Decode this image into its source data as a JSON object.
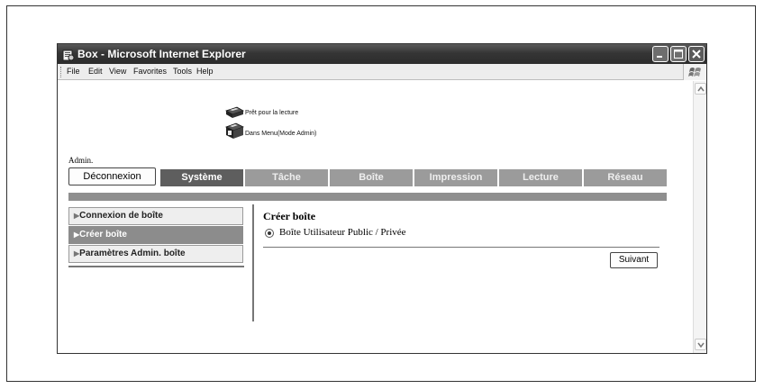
{
  "window": {
    "title": "Box - Microsoft Internet Explorer"
  },
  "menubar": {
    "items": [
      "File",
      "Edit",
      "View",
      "Favorites",
      "Tools",
      "Help"
    ]
  },
  "status": {
    "line1": "Prêt pour la lecture",
    "line2": "Dans Menu(Mode Admin)"
  },
  "user": {
    "label": "Admin."
  },
  "tabs": {
    "logout": "Déconnexion",
    "items": [
      {
        "label": "Système",
        "state": "active"
      },
      {
        "label": "Tâche",
        "state": "inactive"
      },
      {
        "label": "Boîte",
        "state": "inactive"
      },
      {
        "label": "Impression",
        "state": "inactive"
      },
      {
        "label": "Lecture",
        "state": "inactive"
      },
      {
        "label": "Réseau",
        "state": "inactive"
      }
    ]
  },
  "sidebar": {
    "items": [
      {
        "label": "Connexion de boîte",
        "active": false
      },
      {
        "label": "Créer boîte",
        "active": true
      },
      {
        "label": "Paramètres Admin. boîte",
        "active": false
      }
    ]
  },
  "main": {
    "title": "Créer boîte",
    "radio_label": "Boîte Utilisateur Public / Privée",
    "next_button": "Suivant"
  },
  "icons": {
    "title": "ie-page-icon",
    "printer": "printer-icon",
    "throbber": "windows-flag-icon"
  },
  "colors": {
    "titlebar": "#353535",
    "tab_active": "#5e5e5e",
    "tab_inactive": "#9b9b9b",
    "band": "#8f8f8f",
    "sidebar_active": "#8c8c8c"
  }
}
